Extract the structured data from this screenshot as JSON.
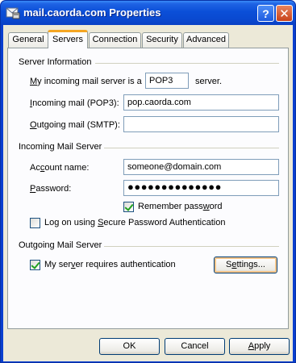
{
  "window": {
    "title": "mail.caorda.com Properties",
    "help_glyph": "?",
    "close_glyph": "✕"
  },
  "tabs": [
    {
      "label": "General",
      "active": false
    },
    {
      "label": "Servers",
      "active": true
    },
    {
      "label": "Connection",
      "active": false
    },
    {
      "label": "Security",
      "active": false
    },
    {
      "label": "Advanced",
      "active": false
    }
  ],
  "server_info": {
    "group_label": "Server Information",
    "incoming_type_prefix_u": "M",
    "incoming_type_prefix_rest": "y incoming mail server is a",
    "incoming_type_value": "POP3",
    "incoming_type_suffix": "server.",
    "incoming_label_u": "I",
    "incoming_label_rest": "ncoming mail (POP3):",
    "incoming_value": "pop.caorda.com",
    "outgoing_label_u": "O",
    "outgoing_label_rest": "utgoing mail (SMTP):",
    "outgoing_value": ""
  },
  "incoming_server": {
    "group_label": "Incoming Mail Server",
    "account_label_pre": "Ac",
    "account_label_u": "c",
    "account_label_rest": "ount name:",
    "account_value": "someone@domain.com",
    "password_label_u": "P",
    "password_label_rest": "assword:",
    "password_value": "●●●●●●●●●●●●●●",
    "remember_label_pre": "Remember pass",
    "remember_label_u": "w",
    "remember_label_rest": "ord",
    "remember_checked": true,
    "spa_label_pre": "Log on using ",
    "spa_label_u": "S",
    "spa_label_rest": "ecure Password Authentication",
    "spa_checked": false
  },
  "outgoing_server": {
    "group_label": "Outgoing Mail Server",
    "auth_label_pre": "My ser",
    "auth_label_u": "v",
    "auth_label_rest": "er requires authentication",
    "auth_checked": true,
    "settings_label_pre": "S",
    "settings_label_u": "e",
    "settings_label_rest": "ttings..."
  },
  "footer": {
    "ok_label": "OK",
    "cancel_label": "Cancel",
    "apply_label_u": "A",
    "apply_label_rest": "pply"
  }
}
